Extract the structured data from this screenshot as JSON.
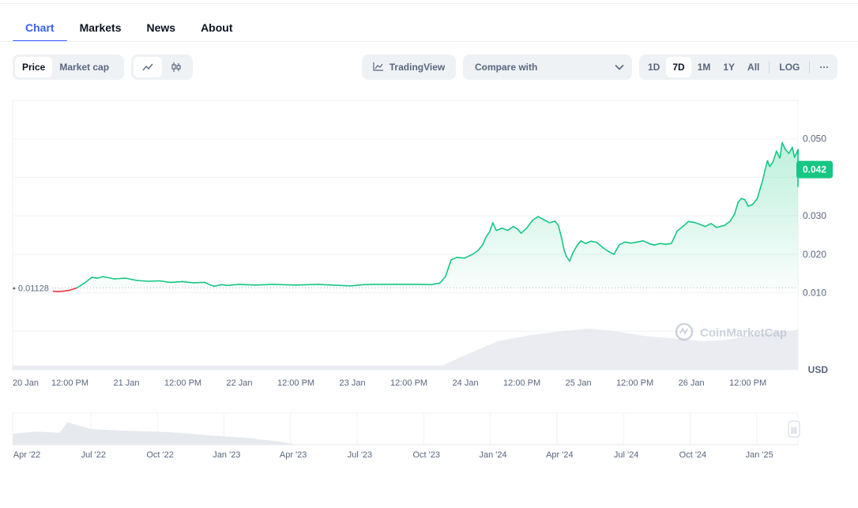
{
  "tabs": [
    {
      "label": "Chart",
      "active": true
    },
    {
      "label": "Markets",
      "active": false
    },
    {
      "label": "News",
      "active": false
    },
    {
      "label": "About",
      "active": false
    }
  ],
  "toolbar": {
    "metric": [
      {
        "label": "Price",
        "active": true
      },
      {
        "label": "Market cap",
        "active": false
      }
    ],
    "chart_styles": [
      {
        "icon": "line-chart-icon",
        "active": true
      },
      {
        "icon": "candlestick-icon",
        "active": false
      }
    ],
    "tradingview_label": "TradingView",
    "compare_label": "Compare with",
    "ranges": [
      {
        "label": "1D",
        "active": false
      },
      {
        "label": "7D",
        "active": true
      },
      {
        "label": "1M",
        "active": false
      },
      {
        "label": "1Y",
        "active": false
      },
      {
        "label": "All",
        "active": false
      }
    ],
    "log_label": "LOG",
    "more_label": "···"
  },
  "colors": {
    "accent": "#3861fb",
    "up": "#16c784",
    "down": "#ea3943",
    "text": "#0d1421",
    "muted": "#58667e"
  },
  "chart_data": {
    "type": "line",
    "currency_label": "USD",
    "watermark": "CoinMarketCap",
    "open_price_label": "0.01128",
    "open_price": 0.01128,
    "current_price_label": "0.042",
    "current_price": 0.042,
    "y_ticks": [
      {
        "value": 0.01,
        "label": "0.010"
      },
      {
        "value": 0.02,
        "label": "0.020"
      },
      {
        "value": 0.03,
        "label": "0.030"
      },
      {
        "value": 0.05,
        "label": "0.050"
      }
    ],
    "ylim": [
      -0.01,
      0.06
    ],
    "xlim": [
      0,
      6.95
    ],
    "x_ticks": [
      {
        "x": 0,
        "label": "20 Jan"
      },
      {
        "x": 0.5,
        "label": "12:00 PM"
      },
      {
        "x": 1,
        "label": "21 Jan"
      },
      {
        "x": 1.5,
        "label": "12:00 PM"
      },
      {
        "x": 2,
        "label": "22 Jan"
      },
      {
        "x": 2.5,
        "label": "12:00 PM"
      },
      {
        "x": 3,
        "label": "23 Jan"
      },
      {
        "x": 3.5,
        "label": "12:00 PM"
      },
      {
        "x": 4,
        "label": "24 Jan"
      },
      {
        "x": 4.5,
        "label": "12:00 PM"
      },
      {
        "x": 5,
        "label": "25 Jan"
      },
      {
        "x": 5.5,
        "label": "12:00 PM"
      },
      {
        "x": 6,
        "label": "26 Jan"
      },
      {
        "x": 6.5,
        "label": "12:00 PM"
      }
    ],
    "series": [
      {
        "points": [
          [
            0.36,
            0.0104
          ],
          [
            0.4,
            0.0103
          ],
          [
            0.45,
            0.0104
          ],
          [
            0.5,
            0.0106
          ],
          [
            0.57,
            0.0113
          ],
          [
            0.63,
            0.0124
          ],
          [
            0.7,
            0.014
          ],
          [
            0.75,
            0.0138
          ],
          [
            0.8,
            0.0142
          ],
          [
            0.9,
            0.0136
          ],
          [
            1.0,
            0.0138
          ],
          [
            1.1,
            0.0132
          ],
          [
            1.2,
            0.013
          ],
          [
            1.3,
            0.0131
          ],
          [
            1.4,
            0.0127
          ],
          [
            1.5,
            0.0129
          ],
          [
            1.6,
            0.0126
          ],
          [
            1.7,
            0.0127
          ],
          [
            1.75,
            0.012
          ],
          [
            1.78,
            0.0117
          ],
          [
            1.85,
            0.0121
          ],
          [
            1.9,
            0.0119
          ],
          [
            2.0,
            0.0122
          ],
          [
            2.15,
            0.012
          ],
          [
            2.3,
            0.0122
          ],
          [
            2.5,
            0.012
          ],
          [
            2.7,
            0.0122
          ],
          [
            2.9,
            0.0119
          ],
          [
            3.0,
            0.0118
          ],
          [
            3.1,
            0.0121
          ],
          [
            3.2,
            0.0122
          ],
          [
            3.4,
            0.0122
          ],
          [
            3.6,
            0.0122
          ],
          [
            3.7,
            0.0121
          ],
          [
            3.78,
            0.0125
          ],
          [
            3.83,
            0.0142
          ],
          [
            3.88,
            0.0185
          ],
          [
            3.93,
            0.0192
          ],
          [
            4.0,
            0.019
          ],
          [
            4.07,
            0.02
          ],
          [
            4.12,
            0.021
          ],
          [
            4.16,
            0.0225
          ],
          [
            4.19,
            0.0245
          ],
          [
            4.22,
            0.0258
          ],
          [
            4.25,
            0.0282
          ],
          [
            4.28,
            0.0262
          ],
          [
            4.33,
            0.0268
          ],
          [
            4.38,
            0.0262
          ],
          [
            4.43,
            0.0272
          ],
          [
            4.47,
            0.0265
          ],
          [
            4.5,
            0.0255
          ],
          [
            4.55,
            0.0268
          ],
          [
            4.6,
            0.0288
          ],
          [
            4.65,
            0.0298
          ],
          [
            4.7,
            0.029
          ],
          [
            4.75,
            0.0282
          ],
          [
            4.8,
            0.0286
          ],
          [
            4.83,
            0.0275
          ],
          [
            4.86,
            0.024
          ],
          [
            4.88,
            0.0212
          ],
          [
            4.9,
            0.0195
          ],
          [
            4.93,
            0.0182
          ],
          [
            4.96,
            0.0205
          ],
          [
            5.0,
            0.0225
          ],
          [
            5.03,
            0.0235
          ],
          [
            5.07,
            0.0228
          ],
          [
            5.12,
            0.0234
          ],
          [
            5.17,
            0.0231
          ],
          [
            5.22,
            0.0218
          ],
          [
            5.27,
            0.0208
          ],
          [
            5.32,
            0.02
          ],
          [
            5.37,
            0.0225
          ],
          [
            5.42,
            0.0232
          ],
          [
            5.47,
            0.0229
          ],
          [
            5.53,
            0.0232
          ],
          [
            5.58,
            0.0235
          ],
          [
            5.63,
            0.0228
          ],
          [
            5.68,
            0.0224
          ],
          [
            5.73,
            0.0228
          ],
          [
            5.78,
            0.0226
          ],
          [
            5.83,
            0.0228
          ],
          [
            5.88,
            0.026
          ],
          [
            5.93,
            0.0272
          ],
          [
            5.98,
            0.0285
          ],
          [
            6.03,
            0.0283
          ],
          [
            6.08,
            0.0278
          ],
          [
            6.13,
            0.0272
          ],
          [
            6.18,
            0.028
          ],
          [
            6.23,
            0.027
          ],
          [
            6.3,
            0.0275
          ],
          [
            6.35,
            0.0286
          ],
          [
            6.39,
            0.0305
          ],
          [
            6.42,
            0.0335
          ],
          [
            6.45,
            0.0345
          ],
          [
            6.48,
            0.0342
          ],
          [
            6.51,
            0.0325
          ],
          [
            6.55,
            0.033
          ],
          [
            6.59,
            0.0345
          ],
          [
            6.62,
            0.0375
          ],
          [
            6.64,
            0.0395
          ],
          [
            6.66,
            0.042
          ],
          [
            6.68,
            0.0443
          ],
          [
            6.7,
            0.0428
          ],
          [
            6.73,
            0.044
          ],
          [
            6.76,
            0.0468
          ],
          [
            6.79,
            0.045
          ],
          [
            6.81,
            0.049
          ],
          [
            6.84,
            0.0472
          ],
          [
            6.87,
            0.0462
          ],
          [
            6.9,
            0.0478
          ],
          [
            6.92,
            0.0452
          ],
          [
            6.95,
            0.0472
          ],
          [
            6.98,
            0.046
          ],
          [
            7.01,
            0.047
          ],
          [
            7.04,
            0.0445
          ],
          [
            7.06,
            0.0435
          ],
          [
            7.08,
            0.039
          ],
          [
            7.1,
            0.0376
          ]
        ]
      }
    ],
    "volume": [
      [
        0.0,
        0.1
      ],
      [
        0.5,
        0.1
      ],
      [
        1.0,
        0.1
      ],
      [
        1.5,
        0.1
      ],
      [
        2.0,
        0.1
      ],
      [
        2.5,
        0.1
      ],
      [
        3.0,
        0.1
      ],
      [
        3.5,
        0.1
      ],
      [
        3.8,
        0.1
      ],
      [
        4.0,
        0.35
      ],
      [
        4.3,
        0.7
      ],
      [
        4.6,
        0.85
      ],
      [
        4.9,
        0.95
      ],
      [
        5.1,
        1.0
      ],
      [
        5.3,
        0.95
      ],
      [
        5.6,
        0.82
      ],
      [
        5.9,
        0.75
      ],
      [
        6.1,
        0.7
      ],
      [
        6.3,
        0.72
      ],
      [
        6.5,
        0.82
      ],
      [
        6.7,
        0.92
      ],
      [
        6.9,
        0.95
      ],
      [
        7.1,
        0.98
      ]
    ]
  },
  "navigator": {
    "labels": [
      "Apr '22",
      "Jul '22",
      "Oct '22",
      "Jan '23",
      "Apr '23",
      "Jul '23",
      "Oct '23",
      "Jan '24",
      "Apr '24",
      "Jul '24",
      "Oct '24",
      "Jan '25"
    ],
    "handle_label": "|||"
  }
}
